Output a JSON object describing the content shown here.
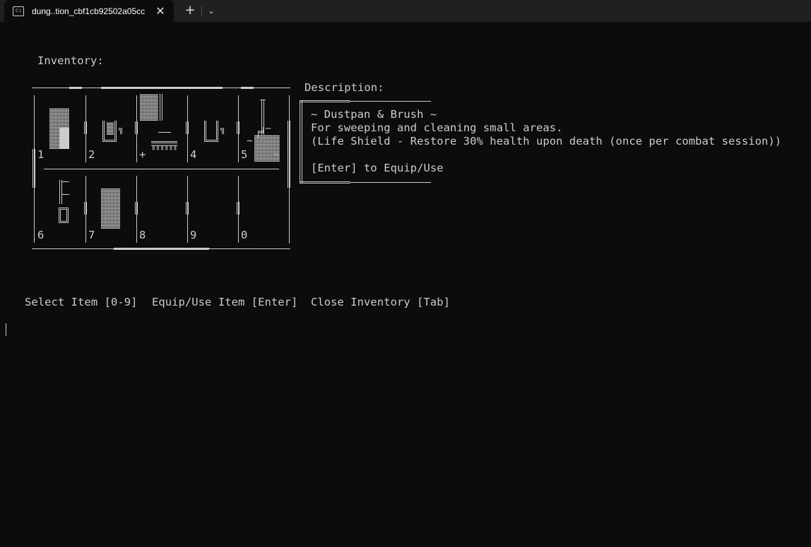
{
  "window": {
    "tab_title": "dung..tion_cbf1cb92502a05cc",
    "tab_icon": "terminal-icon",
    "close_glyph": "✕",
    "new_tab_glyph": "+",
    "dropdown_glyph": "⌄"
  },
  "inventory": {
    "heading": "Inventory:",
    "slots": [
      {
        "key": "1"
      },
      {
        "key": "2"
      },
      {
        "key": "+"
      },
      {
        "key": "4"
      },
      {
        "key": "5"
      },
      {
        "key": "6"
      },
      {
        "key": "7"
      },
      {
        "key": "8"
      },
      {
        "key": "9"
      },
      {
        "key": "0"
      }
    ]
  },
  "description": {
    "heading": "Description:",
    "item_name": "~ Dustpan & Brush ~",
    "text": "For sweeping and cleaning small areas.",
    "effect": "(Life Shield - Restore 30% health upon death (once per combat session))",
    "action_hint": "[Enter] to Equip/Use"
  },
  "controls": {
    "select": "Select Item [0-9]",
    "equip": "Equip/Use Item [Enter]",
    "close": "Close Inventory [Tab]"
  }
}
